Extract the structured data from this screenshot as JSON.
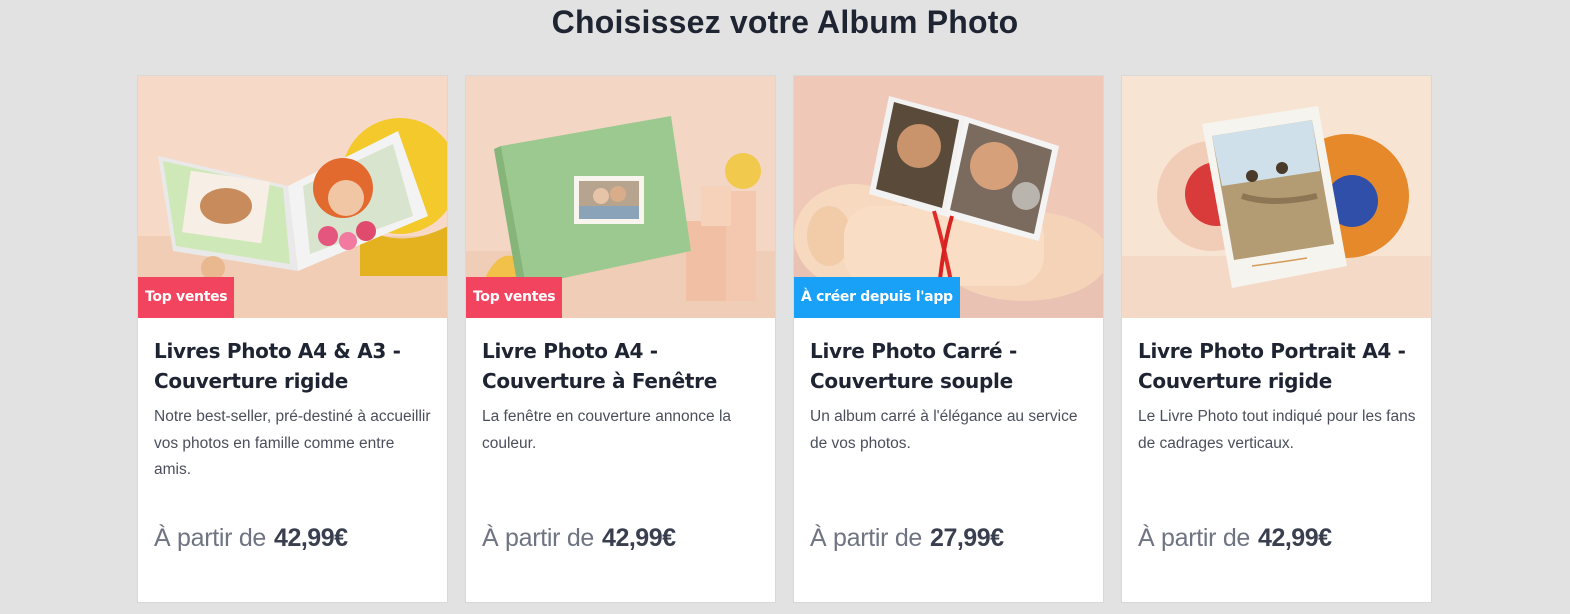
{
  "page": {
    "title": "Choisissez votre Album Photo"
  },
  "colors": {
    "badge_red": "#f2445e",
    "badge_blue": "#18a1f7",
    "background": "#e2e2e2"
  },
  "cards": [
    {
      "image": "open-photo-book-image",
      "badge": "Top ventes",
      "badge_color": "red",
      "title": "Livres Photo A4 & A3 - Couverture rigide",
      "description": "Notre best-seller, pré-destiné à accueillir vos photos en famille comme entre amis.",
      "price_prefix": "À partir de",
      "price": "42,99€"
    },
    {
      "image": "green-window-cover-book-image",
      "badge": "Top ventes",
      "badge_color": "red",
      "title": "Livre Photo A4 - Couverture à Fenêtre",
      "description": "La fenêtre en couverture annonce la couleur.",
      "price_prefix": "À partir de",
      "price": "42,99€"
    },
    {
      "image": "square-softcover-book-image",
      "badge": "À créer depuis l'app",
      "badge_color": "blue",
      "title": "Livre Photo Carré - Couverture souple",
      "description": "Un album carré à l'élégance au service de vos photos.",
      "price_prefix": "À partir de",
      "price": "27,99€"
    },
    {
      "image": "portrait-hardcover-book-image",
      "badge": "",
      "badge_color": "",
      "title": "Livre Photo Portrait A4 - Couverture rigide",
      "description": "Le Livre Photo tout indiqué pour les fans de cadrages verticaux.",
      "price_prefix": "À partir de",
      "price": "42,99€"
    }
  ]
}
